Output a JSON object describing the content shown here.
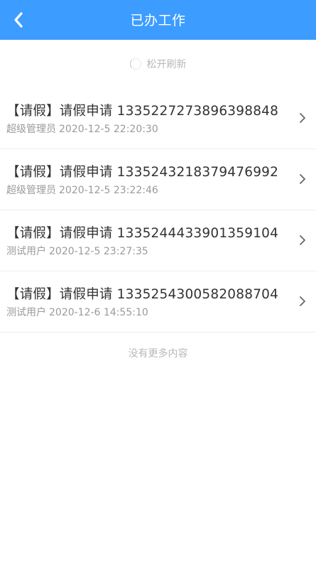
{
  "header": {
    "title": "已办工作",
    "back_icon": "chevron-left-icon"
  },
  "refresh": {
    "label": "松开刷新"
  },
  "items": [
    {
      "title": "【请假】请假申请 1335227273896398848",
      "user": "超级管理员",
      "date": "2020-12-5 22:20:30"
    },
    {
      "title": "【请假】请假申请 1335243218379476992",
      "user": "超级管理员",
      "date": "2020-12-5 23:22:46"
    },
    {
      "title": "【请假】请假申请 1335244433901359104",
      "user": "测试用户",
      "date": "2020-12-5 23:27:35"
    },
    {
      "title": "【请假】请假申请 1335254300582088704",
      "user": "测试用户",
      "date": "2020-12-6 14:55:10"
    }
  ],
  "footer": {
    "no_more": "没有更多内容"
  },
  "colors": {
    "navbar": "#3c9cff",
    "title_text": "#333333",
    "meta_text": "#9a9a9a",
    "hint_text": "#b8b8b8"
  }
}
